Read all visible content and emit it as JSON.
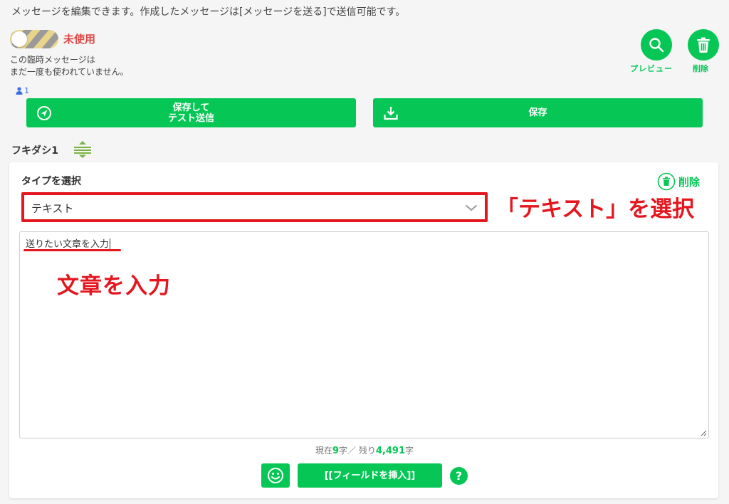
{
  "intro": {
    "text": "メッセージを編集できます。作成したメッセージは[メッセージを送る]で送信可能です。"
  },
  "status": {
    "label": "未使用",
    "note_line1": "この臨時メッセージは",
    "note_line2": "まだ一度も使われていません。",
    "target_count": "1"
  },
  "actions": {
    "preview_label": "プレビュー",
    "delete_label": "削除",
    "test_send_line1": "保存して",
    "test_send_line2": "テスト送信",
    "save_label": "保存"
  },
  "balloon": {
    "title": "フキダシ1",
    "type_label": "タイプを選択",
    "delete_label": "削除",
    "selected_type": "テキスト",
    "message_text": "送りたい文章を入力",
    "count_prefix": "現在",
    "count_current": "9",
    "count_mid": "字／ 残り",
    "count_remaining": "4,491",
    "count_suffix": "字",
    "field_button_label": "[[フィールドを挿入]]",
    "help_label": "?"
  },
  "annotations": {
    "select_type": "「テキスト」を選択",
    "enter_text": "文章を入力"
  },
  "colors": {
    "brand_green": "#06c755",
    "annotation_red": "#e4161e",
    "status_red": "#e04848",
    "count_blue": "#3a6ee8"
  }
}
